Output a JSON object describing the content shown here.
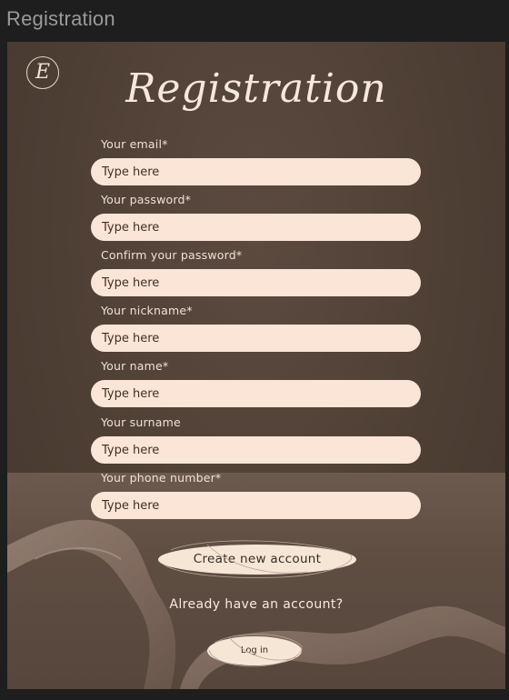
{
  "window": {
    "title": "Registration"
  },
  "brand": {
    "logo_letter": "E"
  },
  "form": {
    "heading": "Registration",
    "fields": [
      {
        "label": "Your email*",
        "placeholder": "Type here"
      },
      {
        "label": "Your password*",
        "placeholder": "Type here"
      },
      {
        "label": "Confirm your password*",
        "placeholder": "Type here"
      },
      {
        "label": "Your nickname*",
        "placeholder": "Type here"
      },
      {
        "label": "Your name*",
        "placeholder": "Type here"
      },
      {
        "label": "Your surname",
        "placeholder": "Type here"
      },
      {
        "label": "Your phone number*",
        "placeholder": "Type here"
      }
    ],
    "create_button": "Create new account",
    "already_text": "Already have an account?",
    "login_button": "Log in"
  },
  "colors": {
    "page_bg": "#1e1e1e",
    "card_bg": "#4e3f35",
    "input_bg": "#fbe5d6",
    "button_bg": "#f6e6d6",
    "text_light": "#efe2d4"
  }
}
